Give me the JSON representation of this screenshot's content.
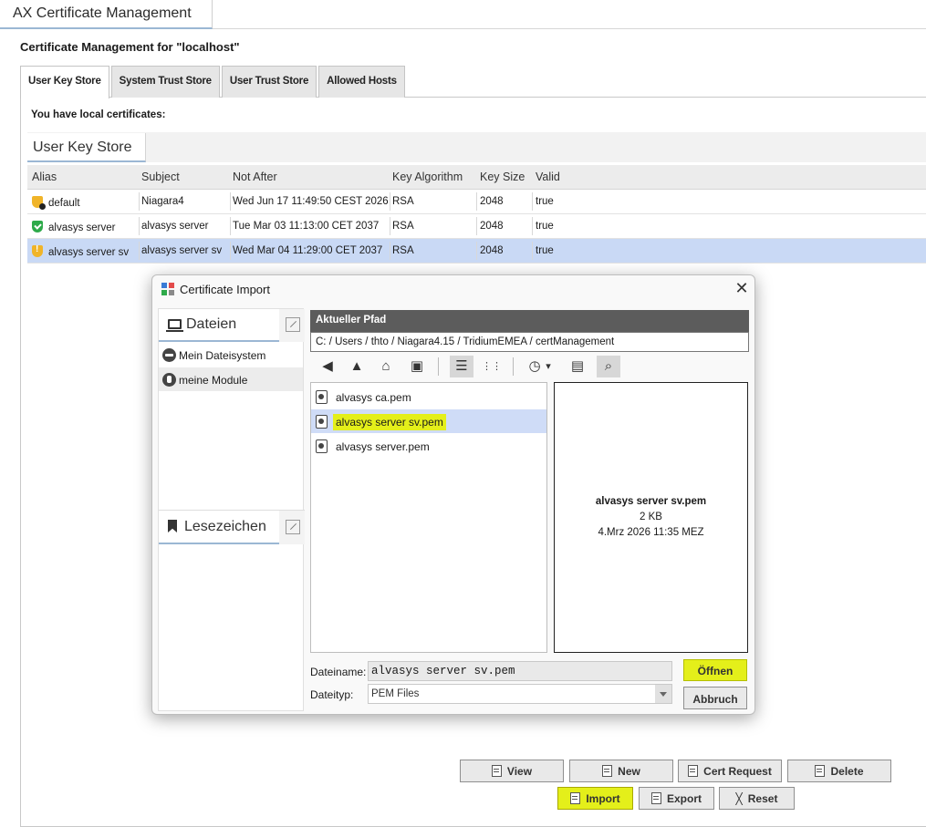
{
  "app": {
    "title": "AX Certificate Management"
  },
  "header": {
    "management_title": "Certificate Management for \"localhost\""
  },
  "tabs": [
    {
      "label": "User Key Store",
      "active": true
    },
    {
      "label": "System Trust Store",
      "active": false
    },
    {
      "label": "User Trust Store",
      "active": false
    },
    {
      "label": "Allowed Hosts",
      "active": false
    }
  ],
  "main": {
    "local_certs_label": "You have local certificates:",
    "store_title": "User Key Store",
    "table": {
      "columns": [
        "Alias",
        "Subject",
        "Not After",
        "Key Algorithm",
        "Key Size",
        "Valid"
      ],
      "rows": [
        {
          "alias": "default",
          "subject": "Niagara4",
          "not_after": "Wed Jun 17 11:49:50 CEST 2026",
          "key_algorithm": "RSA",
          "key_size": "2048",
          "valid": "true",
          "icon": "shield-warning-icon",
          "selected": false
        },
        {
          "alias": "alvasys server",
          "subject": "alvasys server",
          "not_after": "Tue Mar 03 11:13:00 CET 2037",
          "key_algorithm": "RSA",
          "key_size": "2048",
          "valid": "true",
          "icon": "shield-check-icon",
          "selected": false
        },
        {
          "alias": "alvasys server sv",
          "subject": "alvasys server sv",
          "not_after": "Wed Mar 04 11:29:00 CET 2037",
          "key_algorithm": "RSA",
          "key_size": "2048",
          "valid": "true",
          "icon": "shield-exclamation-icon",
          "selected": true
        }
      ]
    }
  },
  "dialog": {
    "title": "Certificate Import",
    "close": "✕",
    "sidebar": {
      "files_title": "Dateien",
      "items": [
        {
          "label": "Mein Dateisystem",
          "icon": "drive-icon"
        },
        {
          "label": "meine Module",
          "icon": "module-icon"
        }
      ],
      "bookmarks_title": "Lesezeichen"
    },
    "path_header": "Aktueller Pfad",
    "path": "C: / Users / thto / Niagara4.15 / TridiumEMEA / certManagement",
    "toolbar": {
      "back": "◀",
      "up": "▲",
      "home": "⌂",
      "new_folder": "▣",
      "list_view": "☰",
      "details_view": "⋮⋮",
      "history": "◷",
      "history_dd": "▾",
      "save": "▤",
      "preview": "⌕"
    },
    "files": [
      {
        "name": "alvasys ca.pem",
        "selected": false
      },
      {
        "name": "alvasys server sv.pem",
        "selected": true
      },
      {
        "name": "alvasys server.pem",
        "selected": false
      }
    ],
    "preview": {
      "name": "alvasys server sv.pem",
      "size": "2 KB",
      "date": "4.Mrz 2026 11:35 MEZ"
    },
    "filename_label": "Dateiname:",
    "filename_value": "alvasys server sv.pem",
    "filetype_label": "Dateityp:",
    "filetype_value": "PEM Files",
    "open_button": "Öffnen",
    "cancel_button": "Abbruch"
  },
  "actions": {
    "view": "View",
    "new": "New",
    "cert_request": "Cert Request",
    "delete": "Delete",
    "import": "Import",
    "export": "Export",
    "reset": "Reset"
  },
  "colors": {
    "highlight": "#e4ef1a",
    "selection": "#c9d9f5",
    "accent_underline": "#9bb7d4"
  }
}
